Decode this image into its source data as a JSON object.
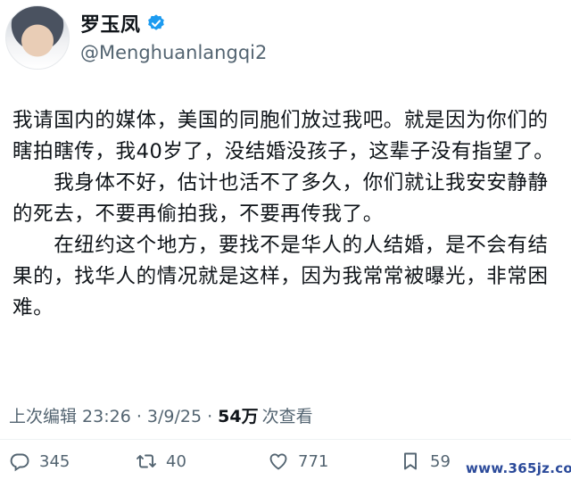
{
  "user": {
    "display_name": "罗玉凤",
    "handle": "@Menghuanlangqi2"
  },
  "tweet": {
    "paragraphs": [
      "我请国内的媒体，美国的同胞们放过我吧。就是因为你们的瞎拍瞎传，我40岁了，没结婚没孩子，这辈子没有指望了。",
      "　　我身体不好，估计也活不了多久，你们就让我安安静静的死去，不要再偷拍我，不要再传我了。",
      "　　在纽约这个地方，要找不是华人的人结婚，是不会有结果的，找华人的情况就是这样，因为我常常被曝光，非常困难。"
    ]
  },
  "meta": {
    "edited_prefix": "上次编辑 23:26 · 3/9/25 ·",
    "views_count": "54万",
    "views_label": "次查看"
  },
  "actions": {
    "replies": "345",
    "retweets": "40",
    "likes": "771",
    "bookmarks": "59"
  },
  "watermark": "www.365jz.com",
  "colors": {
    "text": "#0f1419",
    "secondary": "#536471",
    "verified": "#1d9bf0"
  }
}
